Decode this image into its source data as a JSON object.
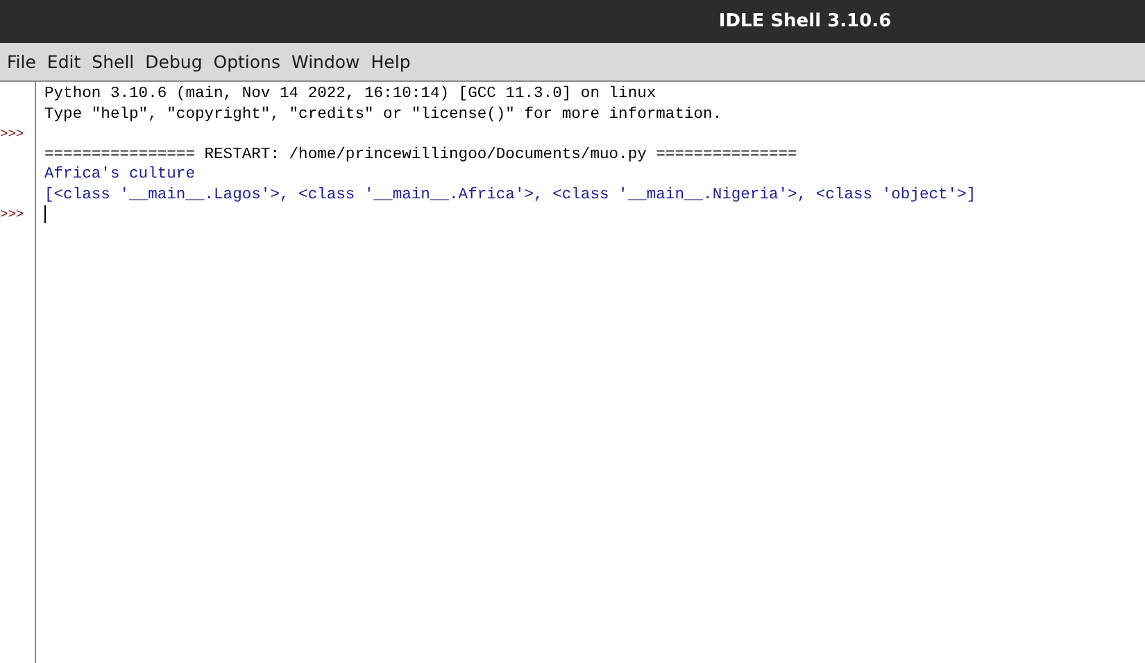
{
  "window": {
    "title": "IDLE Shell 3.10.6"
  },
  "menu": [
    {
      "label": "File"
    },
    {
      "label": "Edit"
    },
    {
      "label": "Shell"
    },
    {
      "label": "Debug"
    },
    {
      "label": "Options"
    },
    {
      "label": "Window"
    },
    {
      "label": "Help"
    }
  ],
  "shell": {
    "lines": [
      {
        "kind": "banner",
        "text": "Python 3.10.6 (main, Nov 14 2022, 16:10:14) [GCC 11.3.0] on linux"
      },
      {
        "kind": "banner",
        "text": "Type \"help\", \"copyright\", \"credits\" or \"license()\" for more information."
      },
      {
        "kind": "input",
        "prompt": ">>>"
      },
      {
        "kind": "banner",
        "text": "================ RESTART: /home/princewillingoo/Documents/muo.py ==============="
      },
      {
        "kind": "stdout",
        "text": "Africa's culture"
      },
      {
        "kind": "stdout",
        "text": "[<class '__main__.Lagos'>, <class '__main__.Africa'>, <class '__main__.Nigeria'>, <class 'object'>]"
      },
      {
        "kind": "input",
        "prompt": ">>>",
        "cursor": true
      }
    ]
  }
}
